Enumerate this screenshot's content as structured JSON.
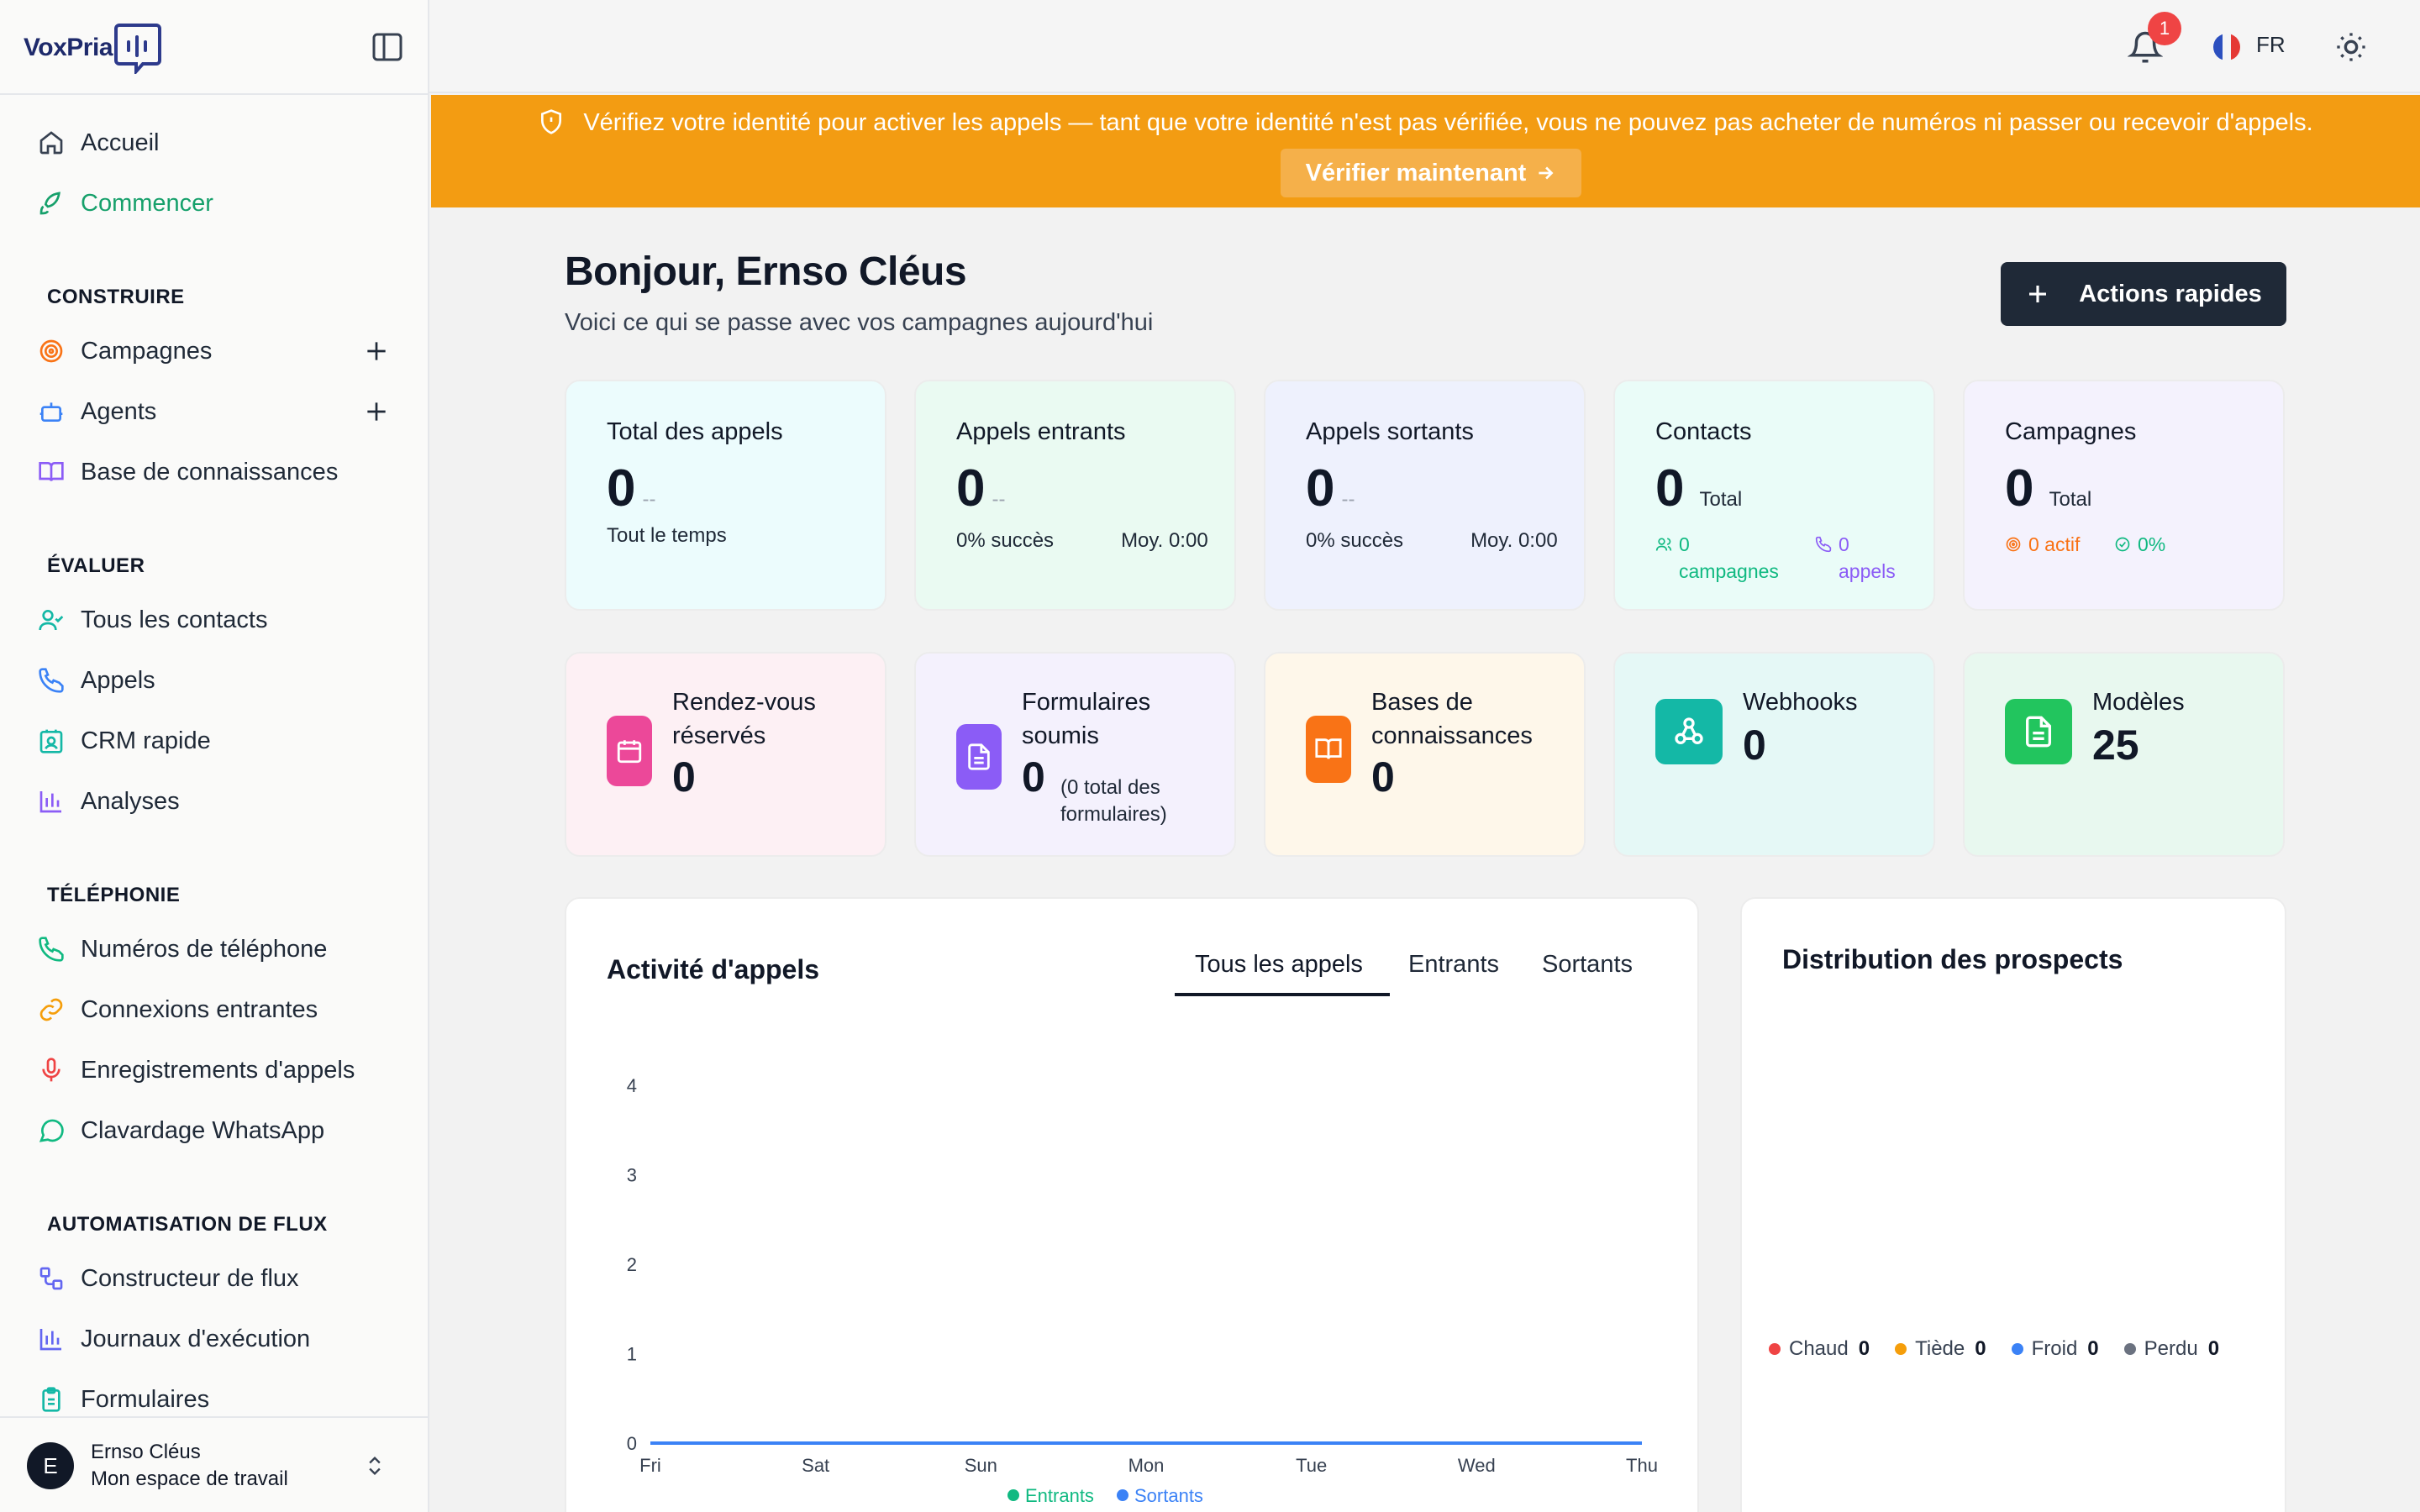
{
  "brand": {
    "name": "VoxPria"
  },
  "sidebar": {
    "top_items": [
      {
        "label": "Accueil",
        "icon": "home-icon"
      },
      {
        "label": "Commencer",
        "icon": "rocket-icon",
        "active": true
      }
    ],
    "sections": [
      {
        "title": "CONSTRUIRE",
        "items": [
          {
            "label": "Campagnes",
            "icon": "target-icon",
            "addable": true
          },
          {
            "label": "Agents",
            "icon": "bot-icon",
            "addable": true
          },
          {
            "label": "Base de connaissances",
            "icon": "book-icon"
          }
        ]
      },
      {
        "title": "ÉVALUER",
        "items": [
          {
            "label": "Tous les contacts",
            "icon": "user-check-icon"
          },
          {
            "label": "Appels",
            "icon": "phone-icon"
          },
          {
            "label": "CRM rapide",
            "icon": "contact-card-icon"
          },
          {
            "label": "Analyses",
            "icon": "bar-chart-icon"
          }
        ]
      },
      {
        "title": "TÉLÉPHONIE",
        "items": [
          {
            "label": "Numéros de téléphone",
            "icon": "phone-icon"
          },
          {
            "label": "Connexions entrantes",
            "icon": "link-icon"
          },
          {
            "label": "Enregistrements d'appels",
            "icon": "mic-icon"
          },
          {
            "label": "Clavardage WhatsApp",
            "icon": "chat-icon"
          }
        ]
      },
      {
        "title": "AUTOMATISATION DE FLUX",
        "items": [
          {
            "label": "Constructeur de flux",
            "icon": "workflow-icon"
          },
          {
            "label": "Journaux d'exécution",
            "icon": "bar-chart-icon"
          },
          {
            "label": "Formulaires",
            "icon": "clipboard-icon"
          }
        ]
      }
    ],
    "user": {
      "initial": "E",
      "name": "Ernso Cléus",
      "workspace": "Mon espace de travail"
    }
  },
  "header": {
    "notifications": "1",
    "language": "FR"
  },
  "banner": {
    "message": "Vérifiez votre identité pour activer les appels — tant que votre identité n'est pas vérifiée, vous ne pouvez pas acheter de numéros ni passer ou recevoir d'appels.",
    "button": "Vérifier maintenant"
  },
  "greeting": {
    "title": "Bonjour, Ernso Cléus",
    "subtitle": "Voici ce qui se passe avec vos campagnes aujourd'hui"
  },
  "quick_actions": "Actions rapides",
  "stats": {
    "total": {
      "title": "Total des appels",
      "value": "0",
      "dash": "--",
      "sub": "Tout le temps"
    },
    "inbound": {
      "title": "Appels entrants",
      "value": "0",
      "dash": "--",
      "success": "0% succès",
      "avg": "Moy. 0:00"
    },
    "outbound": {
      "title": "Appels sortants",
      "value": "0",
      "dash": "--",
      "success": "0% succès",
      "avg": "Moy. 0:00"
    },
    "contacts": {
      "title": "Contacts",
      "value": "0",
      "unit": "Total",
      "campaigns_count": "0",
      "campaigns_label": "campagnes",
      "calls_count": "0",
      "calls_label": "appels"
    },
    "campaigns": {
      "title": "Campagnes",
      "value": "0",
      "unit": "Total",
      "active": "0 actif",
      "rate": "0%"
    }
  },
  "resources": {
    "appointments": {
      "title": "Rendez-vous réservés",
      "value": "0"
    },
    "forms": {
      "title": "Formulaires soumis",
      "value": "0",
      "note": "(0 total des formulaires)"
    },
    "kb": {
      "title": "Bases de connaissances",
      "value": "0"
    },
    "webhooks": {
      "title": "Webhooks",
      "value": "0"
    },
    "templates": {
      "title": "Modèles",
      "value": "25"
    }
  },
  "activity": {
    "title": "Activité d'appels",
    "tabs": [
      "Tous les appels",
      "Entrants",
      "Sortants"
    ],
    "active_tab": 0
  },
  "distribution": {
    "title": "Distribution des prospects",
    "legend": [
      {
        "label": "Chaud",
        "value": "0",
        "color": "#ef4444"
      },
      {
        "label": "Tiède",
        "value": "0",
        "color": "#f59e0b"
      },
      {
        "label": "Froid",
        "value": "0",
        "color": "#3b82f6"
      },
      {
        "label": "Perdu",
        "value": "0",
        "color": "#6b7280"
      }
    ]
  },
  "chart_data": {
    "type": "line",
    "x": [
      "Fri",
      "Sat",
      "Sun",
      "Mon",
      "Tue",
      "Wed",
      "Thu"
    ],
    "series": [
      {
        "name": "Entrants",
        "values": [
          0,
          0,
          0,
          0,
          0,
          0,
          0
        ],
        "color": "#10b981"
      },
      {
        "name": "Sortants",
        "values": [
          0,
          0,
          0,
          0,
          0,
          0,
          0
        ],
        "color": "#3b82f6"
      }
    ],
    "ylim": [
      0,
      4
    ],
    "yticks": [
      0,
      1,
      2,
      3,
      4
    ],
    "xlabel": "",
    "ylabel": "",
    "grid": false,
    "legend": "bottom"
  }
}
